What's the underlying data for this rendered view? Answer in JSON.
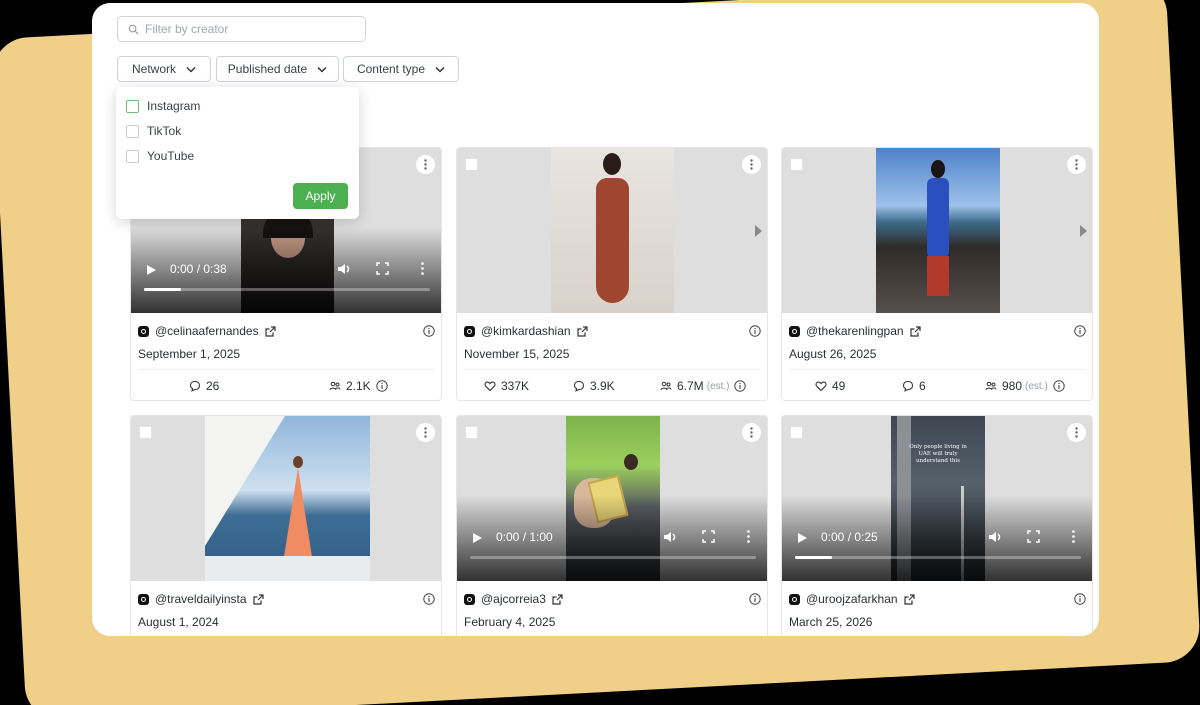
{
  "search": {
    "placeholder": "Filter by creator"
  },
  "filters": [
    {
      "label": "Network"
    },
    {
      "label": "Published date"
    },
    {
      "label": "Content type"
    }
  ],
  "network_dropdown": {
    "options": [
      {
        "label": "Instagram",
        "checked": false
      },
      {
        "label": "TikTok",
        "checked": false
      },
      {
        "label": "YouTube",
        "checked": false
      }
    ],
    "apply_label": "Apply"
  },
  "posts": [
    {
      "handle": "@celinaafernandes",
      "network": "instagram-icon",
      "date": "September 1, 2025",
      "media": {
        "kind": "video",
        "time": "0:00 / 0:38",
        "progress": 0.13
      },
      "metrics": [
        {
          "icon": "comment-icon",
          "value": "26"
        },
        {
          "icon": "reach-icon",
          "value": "2.1K",
          "info": true
        }
      ]
    },
    {
      "handle": "@kimkardashian",
      "network": "instagram-icon",
      "date": "November 15, 2025",
      "media": {
        "kind": "carousel"
      },
      "metrics": [
        {
          "icon": "heart-icon",
          "value": "337K"
        },
        {
          "icon": "comment-icon",
          "value": "3.9K"
        },
        {
          "icon": "reach-icon",
          "value": "6.7M",
          "est": "(est.)",
          "info": true
        }
      ]
    },
    {
      "handle": "@thekarenlingpan",
      "network": "instagram-icon",
      "date": "August 26, 2025",
      "media": {
        "kind": "carousel"
      },
      "metrics": [
        {
          "icon": "heart-icon",
          "value": "49"
        },
        {
          "icon": "comment-icon",
          "value": "6"
        },
        {
          "icon": "reach-icon",
          "value": "980",
          "est": "(est.)",
          "info": true
        }
      ]
    },
    {
      "handle": "@traveldailyinsta",
      "network": "instagram-icon",
      "date": "August 1, 2024",
      "media": {
        "kind": "image"
      }
    },
    {
      "handle": "@ajcorreia3",
      "network": "instagram-icon",
      "date": "February 4, 2025",
      "media": {
        "kind": "video",
        "time": "0:00 / 1:00",
        "progress": 0
      }
    },
    {
      "handle": "@uroojzafarkhan",
      "network": "instagram-icon",
      "date": "March 25, 2026",
      "media": {
        "kind": "video",
        "time": "0:00 / 0:25",
        "progress": 0.13,
        "overlay_text": "Only people living in UAE will truly understand this"
      }
    }
  ],
  "colors": {
    "accent": "#4caf50",
    "backdrop": "#f0cf88"
  }
}
